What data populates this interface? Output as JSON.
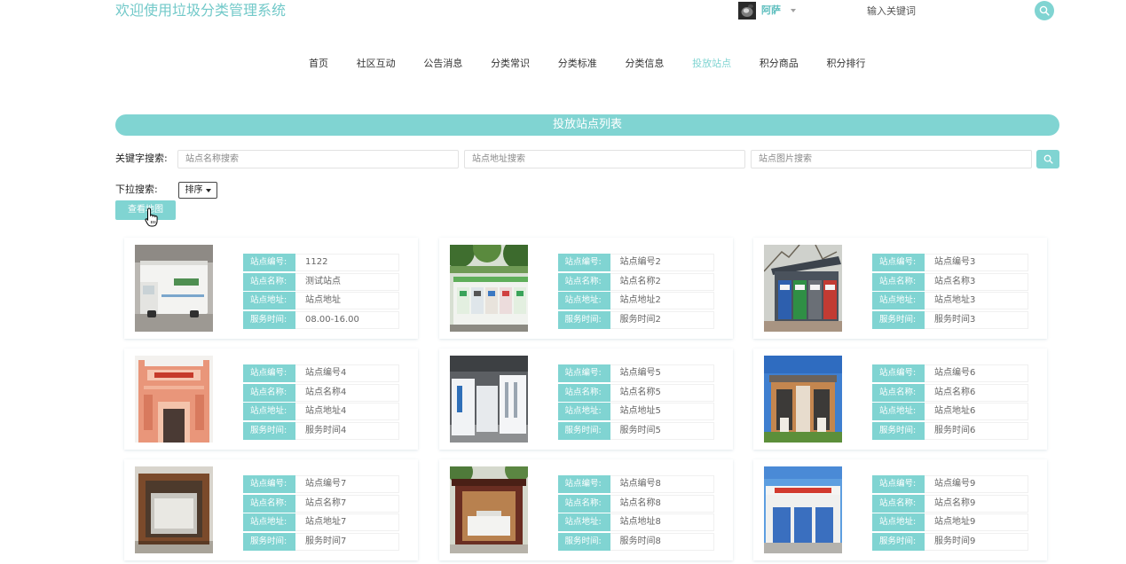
{
  "header": {
    "title": "欢迎使用垃圾分类管理系统",
    "user": {
      "name": "阿萨",
      "avatar_icon": "user-avatar",
      "caret_icon": "caret-down-icon"
    },
    "search": {
      "placeholder": "输入关键词",
      "value": "",
      "button_icon": "search-icon"
    }
  },
  "nav": {
    "items": [
      {
        "label": "首页",
        "active": false
      },
      {
        "label": "社区互动",
        "active": false
      },
      {
        "label": "公告消息",
        "active": false
      },
      {
        "label": "分类常识",
        "active": false
      },
      {
        "label": "分类标准",
        "active": false
      },
      {
        "label": "分类信息",
        "active": false
      },
      {
        "label": "投放站点",
        "active": true
      },
      {
        "label": "积分商品",
        "active": false
      },
      {
        "label": "积分排行",
        "active": false
      }
    ]
  },
  "banner": {
    "title": "投放站点列表"
  },
  "filters": {
    "keyword_label": "关键字搜索:",
    "inputs": [
      {
        "placeholder": "站点名称搜索",
        "value": ""
      },
      {
        "placeholder": "站点地址搜索",
        "value": ""
      },
      {
        "placeholder": "站点图片搜索",
        "value": ""
      }
    ],
    "search_button_icon": "search-icon",
    "dropdown_label": "下拉搜索:",
    "sort_select": {
      "label": "排序",
      "icon": "caret-down-icon"
    },
    "map_button": "查看地图"
  },
  "station_fields": [
    "站点编号:",
    "站点名称:",
    "站点地址:",
    "服务时间:"
  ],
  "stations": [
    {
      "id": "1122",
      "name": "测试站点",
      "address": "站点地址",
      "hours": "08.00-16.00"
    },
    {
      "id": "站点编号2",
      "name": "站点名称2",
      "address": "站点地址2",
      "hours": "服务时间2"
    },
    {
      "id": "站点编号3",
      "name": "站点名称3",
      "address": "站点地址3",
      "hours": "服务时间3"
    },
    {
      "id": "站点编号4",
      "name": "站点名称4",
      "address": "站点地址4",
      "hours": "服务时间4"
    },
    {
      "id": "站点编号5",
      "name": "站点名称5",
      "address": "站点地址5",
      "hours": "服务时间5"
    },
    {
      "id": "站点编号6",
      "name": "站点名称6",
      "address": "站点地址6",
      "hours": "服务时间6"
    },
    {
      "id": "站点编号7",
      "name": "站点名称7",
      "address": "站点地址7",
      "hours": "服务时间7"
    },
    {
      "id": "站点编号8",
      "name": "站点名称8",
      "address": "站点地址8",
      "hours": "服务时间8"
    },
    {
      "id": "站点编号9",
      "name": "站点名称9",
      "address": "站点地址9",
      "hours": "服务时间9"
    }
  ],
  "cursor_icon": "hand-pointer-icon",
  "colors": {
    "accent": "#80d4d2",
    "title": "#72c9c9",
    "user_name": "#5fbfbf",
    "text": "#333333",
    "muted": "#666666"
  }
}
